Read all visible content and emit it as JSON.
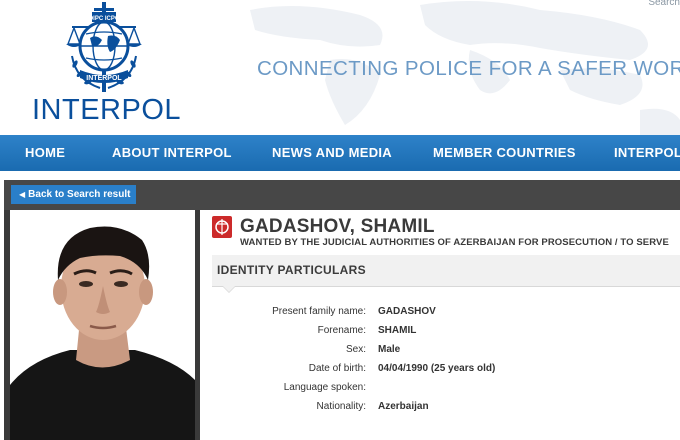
{
  "header": {
    "search_label": "Search",
    "logo_text": "INTERPOL",
    "emblem_ribbon": "INTERPOL",
    "emblem_top": "OIPC ICPO",
    "slogan": "CONNECTING POLICE FOR A SAFER WORLD"
  },
  "nav": {
    "items": [
      {
        "label": "HOME"
      },
      {
        "label": "ABOUT INTERPOL"
      },
      {
        "label": "NEWS AND MEDIA"
      },
      {
        "label": "MEMBER COUNTRIES"
      },
      {
        "label": "INTERPOL"
      }
    ]
  },
  "back_button": {
    "label": "Back to Search result"
  },
  "notice": {
    "name": "GADASHOV, SHAMIL",
    "wanted_text": "WANTED BY THE JUDICIAL AUTHORITIES OF AZERBAIJAN FOR PROSECUTION / TO SERVE",
    "section_title": "IDENTITY PARTICULARS",
    "fields": [
      {
        "label": "Present family name:",
        "value": "GADASHOV"
      },
      {
        "label": "Forename:",
        "value": "SHAMIL"
      },
      {
        "label": "Sex:",
        "value": "Male"
      },
      {
        "label": "Date of birth:",
        "value": "04/04/1990 (25 years old)"
      },
      {
        "label": "Language spoken:",
        "value": ""
      },
      {
        "label": "Nationality:",
        "value": "Azerbaijan"
      }
    ]
  },
  "colors": {
    "brand_blue": "#0a4f9c",
    "nav_blue": "#1f72b8",
    "slogan_blue": "#6c9ac6",
    "notice_red": "#cc2a2a"
  }
}
